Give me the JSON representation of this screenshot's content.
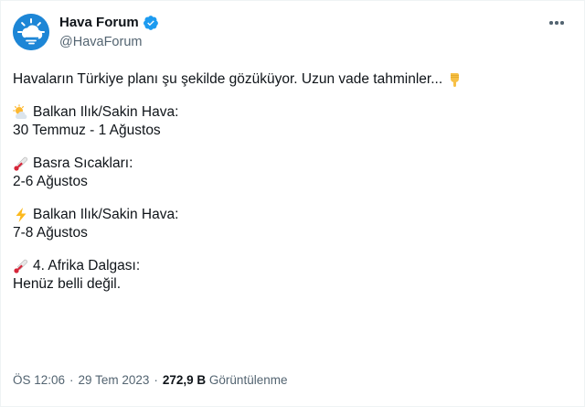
{
  "tweet": {
    "display_name": "Hava Forum",
    "handle": "@HavaForum",
    "icons": {
      "avatar": "hava-forum-logo",
      "verified": "verified-badge-icon",
      "more": "more-options-icon"
    },
    "accent_color": "#1d9bf0",
    "lines": {
      "intro": "Havaların Türkiye planı şu şekilde gözüküyor. Uzun vade tahminler...",
      "p1_title": "Balkan Ilık/Sakin Hava:",
      "p1_date": "30 Temmuz - 1 Ağustos",
      "p2_title": "Basra Sıcakları:",
      "p2_date": "2-6 Ağustos",
      "p3_title": "Balkan Ilık/Sakin Hava:",
      "p3_date": "7-8 Ağustos",
      "p4_title": "4. Afrika Dalgası:",
      "p4_date": "Henüz belli değil."
    },
    "emojis": {
      "intro": "pointing-down-emoji",
      "p1": "sun-behind-cloud-emoji",
      "p2": "thermometer-emoji",
      "p3": "lightning-emoji",
      "p4": "thermometer-emoji"
    },
    "meta": {
      "time": "ÖS 12:06",
      "date": "29 Tem 2023",
      "views_count": "272,9 B",
      "views_label": "Görüntülenme"
    }
  }
}
